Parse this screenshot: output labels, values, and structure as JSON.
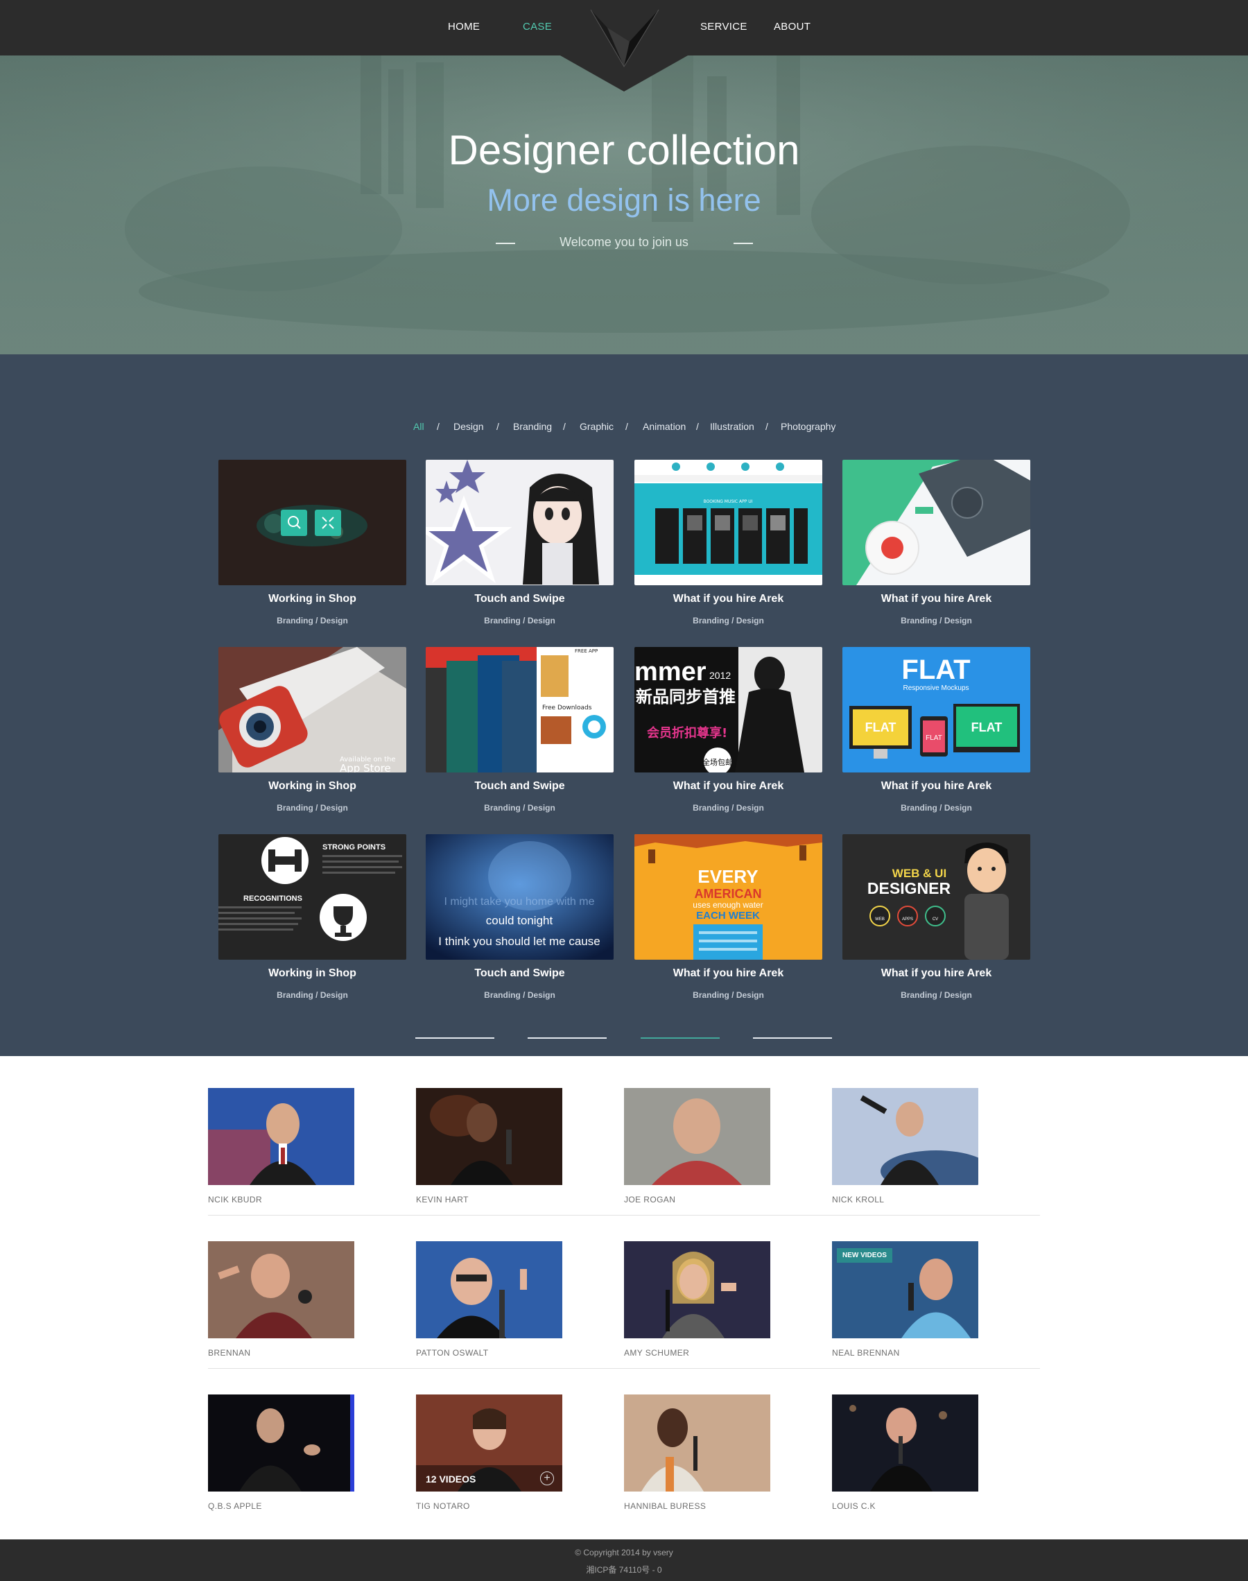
{
  "nav": {
    "items": [
      {
        "label": "HOME",
        "active": false
      },
      {
        "label": "CASE",
        "active": true
      },
      {
        "label": "SERVICE",
        "active": false
      },
      {
        "label": "ABOUT",
        "active": false
      }
    ]
  },
  "hero": {
    "title": "Designer collection",
    "subtitle": "More design is here",
    "welcome": "Welcome you to join us"
  },
  "filters": {
    "items": [
      "All",
      "Design",
      "Branding",
      "Graphic",
      "Animation",
      "Illustration",
      "Photography"
    ],
    "separator": "/",
    "active": "All"
  },
  "cases": [
    {
      "title": "Working in Shop",
      "tag": "Branding / Design"
    },
    {
      "title": "Touch and Swipe",
      "tag": "Branding / Design"
    },
    {
      "title": "What if you hire Arek",
      "tag": "Branding / Design"
    },
    {
      "title": "What if you hire Arek",
      "tag": "Branding / Design"
    },
    {
      "title": "Working in Shop",
      "tag": "Branding / Design"
    },
    {
      "title": "Touch and Swipe",
      "tag": "Branding / Design"
    },
    {
      "title": "What if you hire Arek",
      "tag": "Branding / Design"
    },
    {
      "title": "What if you hire Arek",
      "tag": "Branding / Design"
    },
    {
      "title": "Working in Shop",
      "tag": "Branding / Design"
    },
    {
      "title": "Touch and Swipe",
      "tag": "Branding / Design"
    },
    {
      "title": "What if you hire Arek",
      "tag": "Branding / Design"
    },
    {
      "title": "What if you hire Arek",
      "tag": "Branding / Design"
    }
  ],
  "thumb_text": {
    "booking": "BOOKING MUSIC APP UI",
    "mmer": "mmer",
    "mmer_year": "2012",
    "mmer_cn1": "新品同步首推",
    "mmer_cn2": "会员折扣尊享!",
    "mmer_badge": "全场包邮",
    "flat": "FLAT",
    "flat_sub": "Responsive Mockups",
    "strong_points": "STRONG POINTS",
    "recognitions": "RECOGNITIONS",
    "lyric1": "I might take you home with me",
    "lyric2": "could tonight",
    "lyric3": "I think you should let me cause",
    "every": "EVERY",
    "american": "AMERICAN",
    "uses": "uses enough water",
    "each_week": "EACH WEEK",
    "webui": "WEB & UI",
    "designer": "DESIGNER",
    "app_store": "Available on the",
    "app_store2": "App Store",
    "free_downloads": "Free Downloads",
    "free_app": "FREE APP",
    "web": "WEB",
    "apps": "APPS",
    "cv": "CV"
  },
  "pager": {
    "count": 4,
    "active": 2
  },
  "people": [
    {
      "name": "NCIK KBUDR"
    },
    {
      "name": "KEVIN HART"
    },
    {
      "name": "JOE ROGAN"
    },
    {
      "name": "NICK KROLL"
    },
    {
      "name": "BRENNAN"
    },
    {
      "name": "PATTON OSWALT"
    },
    {
      "name": "AMY SCHUMER"
    },
    {
      "name": "NEAL BRENNAN",
      "badge": "NEW VIDEOS"
    },
    {
      "name": "Q.B.S APPLE"
    },
    {
      "name": "TIG NOTARO",
      "overlay": "12 VIDEOS"
    },
    {
      "name": "HANNIBAL BURESS"
    },
    {
      "name": "LOUIS C.K"
    }
  ],
  "footer": {
    "copyright": "© Copyright 2014 by vsery",
    "icp": "湘ICP备 74110号 - 0"
  },
  "colors": {
    "accent": "#53cbb1",
    "nav_bg": "#2c2c2c",
    "cases_bg": "#3c4a5b",
    "hero_sub": "#93c2ee"
  }
}
